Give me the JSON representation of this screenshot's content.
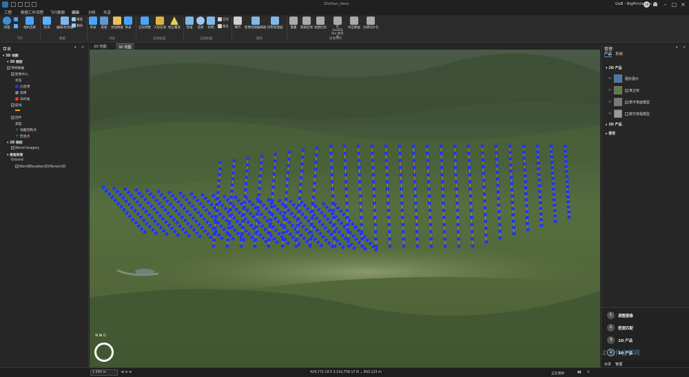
{
  "app": {
    "title": "ZhiXian_Aero",
    "user": "GeB - BigPrintz, Inc",
    "avatar_initials": "GB"
  },
  "ribbon_tabs": [
    "工程",
    "数据工作流程",
    "飞行数据",
    "编辑",
    "分析",
    "共享"
  ],
  "ribbon": {
    "groups": [
      "飞行",
      "数据",
      "浏览",
      "正射处理",
      "正射处理",
      "操作",
      "质量控制"
    ],
    "buttons": [
      {
        "label": "地理",
        "icon": "globe-icon",
        "color": "#3a8fd9"
      },
      {
        "label": "相机选择",
        "icon": "camera-icon",
        "color": "#4aa3ff"
      },
      {
        "label": "检测",
        "icon": "detect-icon",
        "color": "#5fb0ff"
      },
      {
        "label": "编辑/检测器",
        "icon": "edit-icon",
        "color": "#7fb8e8"
      },
      {
        "label": "属性",
        "icon": "attributes-icon",
        "color": "#9cc9f0"
      },
      {
        "label": "删除",
        "icon": "delete-icon",
        "color": "#9cc9f0"
      },
      {
        "label": "目录",
        "icon": "catalog-icon",
        "color": "#4aa3ff"
      },
      {
        "label": "底图",
        "icon": "basemap-icon",
        "color": "#5f9ad0"
      },
      {
        "label": "添加数据",
        "icon": "add-data-icon",
        "color": "#e8c15a"
      },
      {
        "label": "目录",
        "icon": "catalog2-icon",
        "color": "#4aa3ff"
      },
      {
        "label": "正射调整",
        "icon": "ortho-icon",
        "color": "#4aa3ff"
      },
      {
        "label": "工程区域",
        "icon": "project-area-icon",
        "color": "#e0b341"
      },
      {
        "label": "修正覆盖",
        "icon": "warning-icon",
        "color": "#e6d060"
      },
      {
        "label": "管理",
        "icon": "manage-icon",
        "color": "#7fb8e8"
      },
      {
        "label": "选择",
        "icon": "gear-icon",
        "color": "#9cc9f0"
      },
      {
        "label": "控制",
        "icon": "control-icon",
        "color": "#7fb8e8"
      },
      {
        "label": "日志",
        "icon": "log-icon",
        "color": "#cfcfcf"
      },
      {
        "label": "报告",
        "icon": "report-icon",
        "color": "#cfcfcf"
      },
      {
        "label": "细节",
        "icon": "detail-icon",
        "color": "#cfcfcf"
      },
      {
        "label": "影像地图编辑器",
        "icon": "image-editor-icon",
        "color": "#7fb8e8"
      },
      {
        "label": "控制管理器",
        "icon": "control-manager-icon",
        "color": "#7fb8e8"
      },
      {
        "label": "重叠",
        "icon": "overlap-icon",
        "color": "#aaaaaa"
      },
      {
        "label": "隔离区域",
        "icon": "isolate-icon",
        "color": "#aaaaaa"
      },
      {
        "label": "地图比较",
        "icon": "compare-icon",
        "color": "#aaaaaa"
      },
      {
        "label": "在 ArcGIS Pro 中打开",
        "icon": "open-icon",
        "color": "#aaaaaa"
      },
      {
        "label": "导出数据",
        "icon": "export-icon",
        "color": "#aaaaaa"
      },
      {
        "label": "创建切片包",
        "icon": "tile-package-icon",
        "color": "#aaaaaa"
      }
    ]
  },
  "left_pane": {
    "title": "目录",
    "rows": [
      {
        "text": "3D 地图",
        "indent": 0,
        "kind": "folder",
        "bold": true
      },
      {
        "text": "3D 图层",
        "indent": 1,
        "kind": "header",
        "bold": true
      },
      {
        "text": "项目数据",
        "indent": 1,
        "kind": "check"
      },
      {
        "text": "影像中心",
        "indent": 2,
        "kind": "check"
      },
      {
        "text": "状态",
        "indent": 3,
        "kind": "text"
      },
      {
        "text": "已启用",
        "indent": 3,
        "kind": "dot",
        "color": "#1f35ff"
      },
      {
        "text": "禁用",
        "indent": 3,
        "kind": "dot",
        "color": "#8a8a8a"
      },
      {
        "text": "未校准",
        "indent": 3,
        "kind": "dot",
        "color": "#ff3a1f"
      },
      {
        "text": "航线",
        "indent": 2,
        "kind": "check"
      },
      {
        "text": "",
        "indent": 3,
        "kind": "line"
      },
      {
        "text": "控件",
        "indent": 2,
        "kind": "check"
      },
      {
        "text": "类型",
        "indent": 3,
        "kind": "text"
      },
      {
        "text": "地面控制点",
        "indent": 3,
        "kind": "plus"
      },
      {
        "text": "检查点",
        "indent": 3,
        "kind": "plus"
      },
      {
        "text": "2D 图层",
        "indent": 1,
        "kind": "header",
        "bold": true
      },
      {
        "text": "World Imagery",
        "indent": 2,
        "kind": "check"
      },
      {
        "text": "高程表面",
        "indent": 1,
        "kind": "header",
        "bold": true
      },
      {
        "text": "Ground",
        "indent": 2,
        "kind": "text"
      },
      {
        "text": "WorldElevation3D/Terrain3D",
        "indent": 3,
        "kind": "check"
      }
    ]
  },
  "map_tabs": [
    "2D 地图",
    "3D 地图"
  ],
  "map_tab_active": 1,
  "map": {
    "enabled_color": "#1f35ff",
    "line_color": "#f5a623"
  },
  "right_pane": {
    "title": "管理",
    "tabs": [
      "产品",
      "系统"
    ],
    "sections": [
      "2D 产品",
      "3D 产品",
      "报告"
    ],
    "products_2d": [
      "图形展示",
      "真正射",
      "数字表面模型",
      "数字高程模型"
    ],
    "steps": [
      {
        "num": "1",
        "label": "调整图像"
      },
      {
        "num": "2",
        "label": "密度匹配"
      },
      {
        "num": "3",
        "label": "2D 产品"
      },
      {
        "num": "4",
        "label": "3D 产品"
      }
    ],
    "bottom_tabs": [
      "目录",
      "管理"
    ]
  },
  "status": {
    "scale": "1:564 m",
    "coords": "424,772.19 E  3,142,758.17 N  ⌄  893.123 m",
    "hint": "正在更新"
  },
  "watermark": "Z 软件自学网"
}
